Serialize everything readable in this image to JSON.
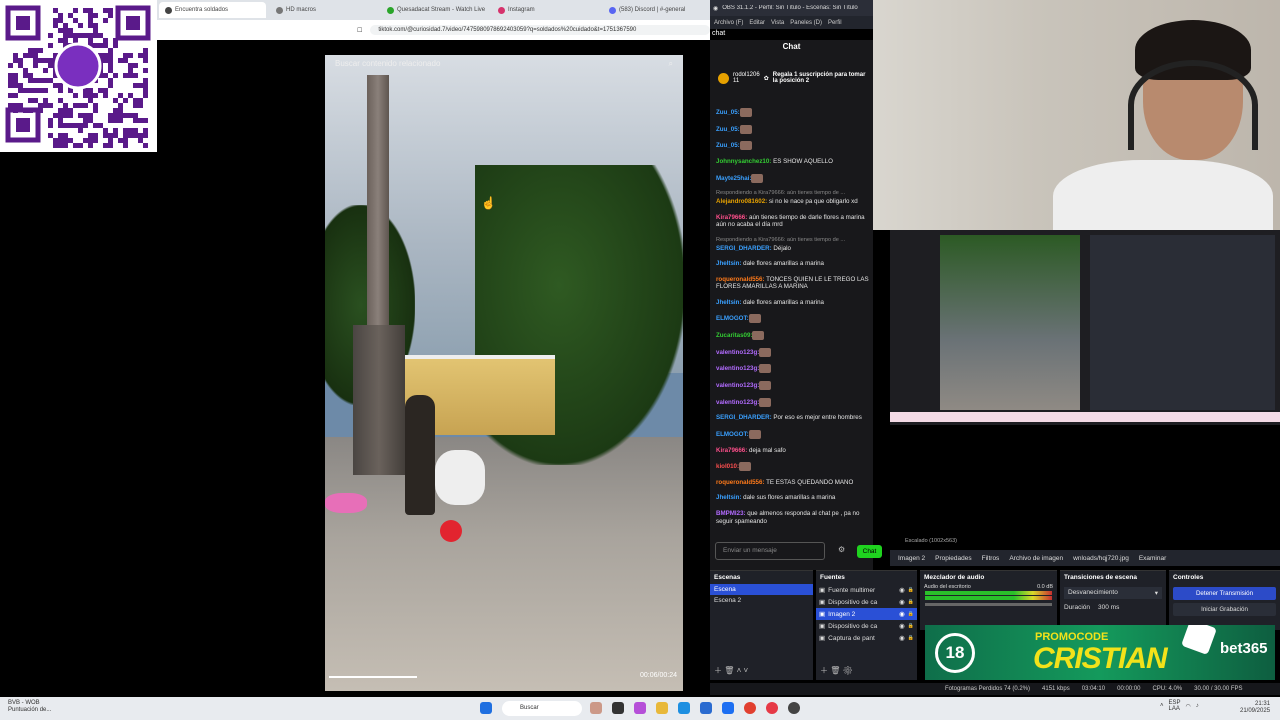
{
  "browser": {
    "tabs": [
      {
        "label": "Encuentra soldados",
        "active": true,
        "color": "#444"
      },
      {
        "label": "HD macros",
        "active": false,
        "color": "#777"
      },
      {
        "label": "Quesadacat Stream - Watch Live",
        "active": false,
        "color": "#2aa52a"
      },
      {
        "label": "Instagram",
        "active": false,
        "color": "#d6336c"
      },
      {
        "label": "(583) Discord | #-general",
        "active": false,
        "color": "#5865f2"
      }
    ],
    "url": "tiktok.com/@curiosidad.7/video/7475980978692403059?q=soldados%20cuidado&t=1751367590"
  },
  "video": {
    "search_placeholder": "Buscar contenido relacionado",
    "time": "00:06/00:24",
    "progress": 0.25
  },
  "obs": {
    "window_title": "OBS 31.1.2 - Perfil: Sin Título - Escenas: Sin Título",
    "menu": [
      "Archivo (F)",
      "Editar",
      "Vista",
      "Paneles (D)",
      "Perfil"
    ],
    "chat_dock_label": "chat",
    "chat_title": "Chat",
    "pinned": {
      "user": "rodol1206",
      "count": "11",
      "text": "Regala 1 suscripción para tomar la posición 2"
    },
    "messages": [
      {
        "user": "Zuu_05:",
        "color": "#3aa0ff",
        "text": "",
        "emote": true
      },
      {
        "user": "Zuu_05:",
        "color": "#3aa0ff",
        "text": "",
        "emote": true
      },
      {
        "user": "Zuu_05:",
        "color": "#3aa0ff",
        "text": "",
        "emote": true
      },
      {
        "user": "Johnnysanchez10:",
        "color": "#33cc33",
        "text": " ES SHOW AQUELLO",
        "emote": false
      },
      {
        "user": "Mayte25hai:",
        "color": "#3aa0ff",
        "text": "",
        "emote": true
      },
      {
        "reply": "Respondiendo a Kira79666: aún tienes tiempo de ..."
      },
      {
        "user": "Alejandro081602:",
        "color": "#e6a100",
        "text": " si no le nace pa que obligarlo xd",
        "emote": false
      },
      {
        "user": "Kira79666:",
        "color": "#ff4f8b",
        "text": " aún tienes tiempo de darle flores a marina aún no acaba el día mrd",
        "emote": false
      },
      {
        "reply": "Respondiendo a Kira79666: aún tienes tiempo de ..."
      },
      {
        "user": "SERGI_DHARDER:",
        "color": "#3aa0ff",
        "text": " Déjalo",
        "emote": false
      },
      {
        "user": "Jheltsin:",
        "color": "#3aa0ff",
        "text": " dale flores amarillas a marina",
        "emote": false
      },
      {
        "user": "roqueronald556:",
        "color": "#ff7a1a",
        "text": " TONCES QUIEN LE LE TREGO LAS FLORES AMARILLAS A MARINA",
        "emote": false
      },
      {
        "user": "Jheltsin:",
        "color": "#3aa0ff",
        "text": " dale flores amarillas a marina",
        "emote": false
      },
      {
        "user": "ELMOGOT:",
        "color": "#3aa0ff",
        "text": "",
        "emote": true
      },
      {
        "user": "Zucaritas09:",
        "color": "#33cc33",
        "text": "",
        "emote": true
      },
      {
        "user": "valentino123g:",
        "color": "#b26bff",
        "text": "",
        "emote": true
      },
      {
        "user": "valentino123g:",
        "color": "#b26bff",
        "text": "",
        "emote": true
      },
      {
        "user": "valentino123g:",
        "color": "#b26bff",
        "text": "",
        "emote": true
      },
      {
        "user": "valentino123g:",
        "color": "#b26bff",
        "text": "",
        "emote": true
      },
      {
        "user": "SERGI_DHARDER:",
        "color": "#3aa0ff",
        "text": " Por eso es mejor entre hombres",
        "emote": false
      },
      {
        "user": "ELMOGOT:",
        "color": "#3aa0ff",
        "text": "",
        "emote": true
      },
      {
        "user": "Kira79666:",
        "color": "#ff4f8b",
        "text": " deja mal safo",
        "emote": false
      },
      {
        "user": "kiol010:",
        "color": "#ff4f4f",
        "text": "",
        "emote": true
      },
      {
        "user": "roqueronald556:",
        "color": "#ff7a1a",
        "text": " TE ESTAS QUEDANDO MANO",
        "emote": false
      },
      {
        "user": "Jheltsin:",
        "color": "#3aa0ff",
        "text": " dale sus flores amarillas a marina",
        "emote": false
      },
      {
        "user": "BMPMI23:",
        "color": "#b26bff",
        "text": " que almenos responda al chat pe , pa no seguir spameando",
        "emote": false
      }
    ],
    "send_placeholder": "Enviar un mensaje",
    "chat_button": "Chat",
    "scaling_text": "Escalado (1002x563)",
    "source_toolbar": [
      "Imagen 2",
      "Propiedades",
      "Filtros",
      "Archivo de imagen",
      "wnloads/hqj720.jpg",
      "Examinar"
    ],
    "scenes": {
      "title": "Escenas",
      "items": [
        "Escena",
        "Escena 2"
      ],
      "selected": 0
    },
    "sources": {
      "title": "Fuentes",
      "items": [
        "Fuente multimer",
        "Dispositivo de ca",
        "Imagen 2",
        "Dispositivo de ca",
        "Captura de pant"
      ],
      "selected": 2
    },
    "mixer": {
      "title": "Mezclador de audio",
      "channel": "Audio del escritorio",
      "level": "0.0 dB"
    },
    "transitions": {
      "title": "Transiciones de escena",
      "type": "Desvanecimiento",
      "duration_label": "Duración",
      "duration": "300 ms"
    },
    "controls": {
      "title": "Controles",
      "stop_stream": "Detener Transmisión",
      "start_record": "Iniciar Grabación"
    },
    "status": {
      "dropped": "Fotogramas Perdidos 74 (0.2%)",
      "bitrate": "4151 kbps",
      "stream_time": "03:04:10",
      "rec_time": "00:00:00",
      "cpu": "CPU: 4.0%",
      "fps": "30.00 / 30.00 FPS"
    }
  },
  "banner": {
    "age": "18",
    "promo": "PROMOCODE",
    "name": "CRISTIAN",
    "brand": "bet365"
  },
  "taskbar": {
    "left_title": "BVB - WOB",
    "left_sub": "Puntuación de...",
    "search": "Buscar",
    "lang": "ESP\nLAA",
    "time": "21:31",
    "date": "21/09/2025"
  }
}
